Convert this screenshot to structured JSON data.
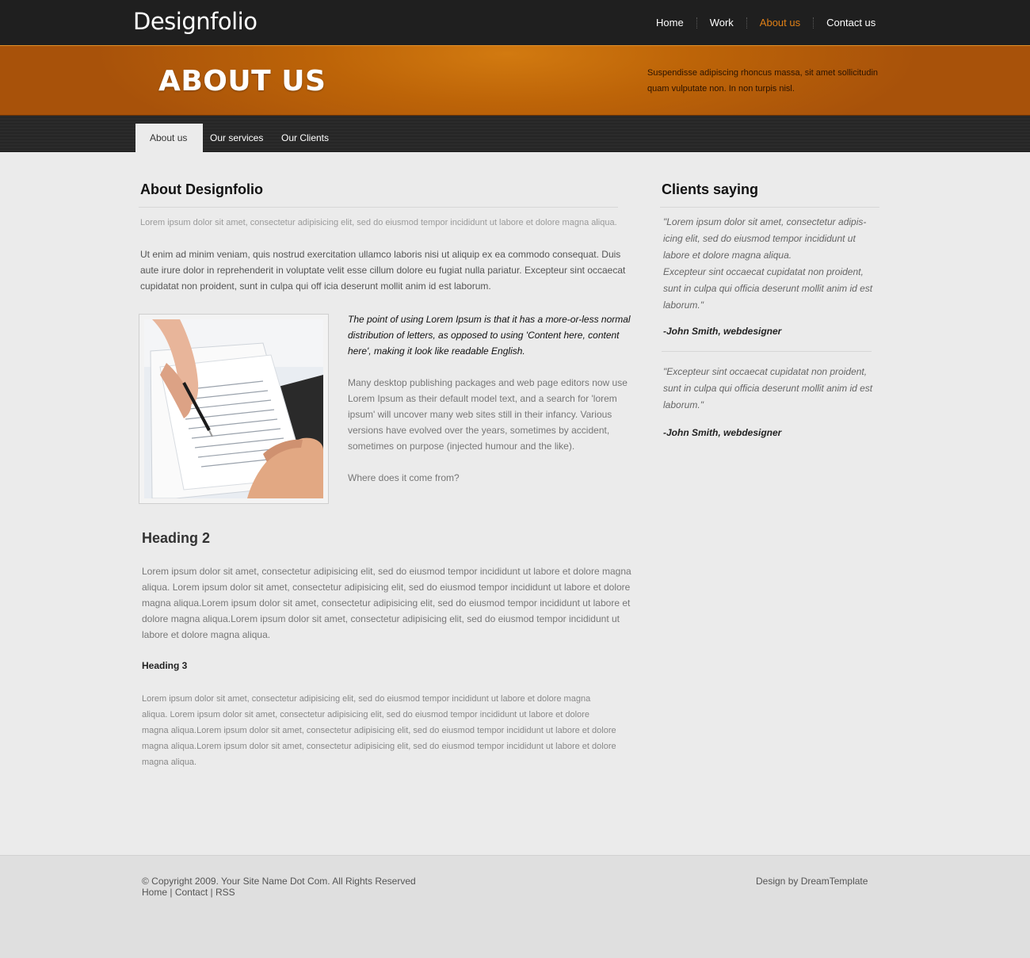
{
  "header": {
    "logo": "Designfolio",
    "nav": [
      {
        "label": "Home"
      },
      {
        "label": "Work"
      },
      {
        "label": "About us",
        "active": true
      },
      {
        "label": "Contact us"
      }
    ]
  },
  "banner": {
    "title": "ABOUT US",
    "text": "Suspendisse adipiscing rhoncus massa, sit amet sollicitudin quam vulputate non. In non turpis nisl."
  },
  "subnav": {
    "tabs": [
      {
        "label": "About us",
        "active": true
      },
      {
        "label": "Our services"
      },
      {
        "label": "Our Clients"
      }
    ]
  },
  "main": {
    "heading": "About Designfolio",
    "intro_small": "Lorem ipsum dolor sit amet, consectetur adipisicing elit, sed do eiusmod tempor incididunt ut labore et dolore magna aliqua.",
    "intro_para": "Ut enim ad minim veniam, quis nostrud exercitation ullamco laboris nisi ut aliquip ex ea commodo consequat. Duis aute irure dolor in reprehenderit in voluptate velit esse cillum dolore eu fugiat nulla pariatur. Excepteur sint occaecat cupidatat non proident, sunt in culpa qui off icia deserunt mollit anim id est laborum.",
    "quote": "The point of using Lorem Ipsum is that it has a more-or-less normal distribution of letters, as opposed to using 'Content here, content here', making it look like readable English.",
    "desc": "Many desktop publishing packages and web page editors now use Lorem Ipsum as their default model text, and a search for 'lorem ipsum' will uncover many web sites still in their infancy. Various versions have evolved over the years, sometimes by accident, sometimes on purpose (injected humour and the like).",
    "where": "Where does it come from?",
    "heading2": "Heading 2",
    "heading2_para": "Lorem ipsum dolor sit amet, consectetur adipisicing elit, sed do eiusmod tempor incididunt ut labore et dolore magna aliqua. Lorem ipsum dolor sit amet, consectetur adipisicing elit, sed do eiusmod tempor incididunt ut labore et dolore magna aliqua.Lorem ipsum dolor sit amet, consectetur adipisicing elit, sed do eiusmod tempor incididunt ut labore et dolore magna aliqua.Lorem ipsum dolor sit amet, consectetur adipisicing elit, sed do eiusmod tempor incididunt ut labore et dolore magna aliqua.",
    "heading3": "Heading 3",
    "heading3_para": "Lorem ipsum dolor sit amet, consectetur adipisicing elit, sed do eiusmod tempor incididunt ut labore et dolore magna aliqua. Lorem ipsum dolor sit amet, consectetur adipisicing elit, sed do eiusmod tempor incididunt ut labore et dolore magna aliqua.Lorem ipsum dolor sit amet, consectetur adipisicing elit, sed do eiusmod tempor incididunt ut labore et dolore magna aliqua.Lorem ipsum dolor sit amet, consectetur adipisicing elit, sed do eiusmod tempor incididunt ut labore et dolore magna aliqua."
  },
  "sidebar": {
    "heading": "Clients saying",
    "testimonials": [
      {
        "line1": "\"Lorem ipsum dolor sit amet, consectetur adipis-icing elit, sed do eiusmod tempor incididunt ut labore et dolore magna aliqua.",
        "line2": "Excepteur sint occaecat cupidatat non proident, sunt in culpa qui officia deserunt mollit anim id est laborum.\"",
        "author": "-John Smith, webdesigner"
      },
      {
        "line1": "\"Excepteur sint occaecat cupidatat non proident, sunt in culpa qui officia deserunt mollit anim id est laborum.\"",
        "author": "-John Smith, webdesigner"
      }
    ]
  },
  "footer": {
    "copyright": "© Copyright 2009. Your Site Name Dot Com. All Rights Reserved",
    "links": [
      {
        "label": "Home"
      },
      {
        "label": "Contact"
      },
      {
        "label": "RSS"
      }
    ],
    "separator": "|",
    "design_by_prefix": "Design by",
    "design_by_link": "DreamTemplate"
  },
  "colors": {
    "accent": "#e08016",
    "banner": "#bd6408",
    "topbar": "#1f1f1f"
  },
  "icons": {
    "photo": "document-signing-photo"
  }
}
